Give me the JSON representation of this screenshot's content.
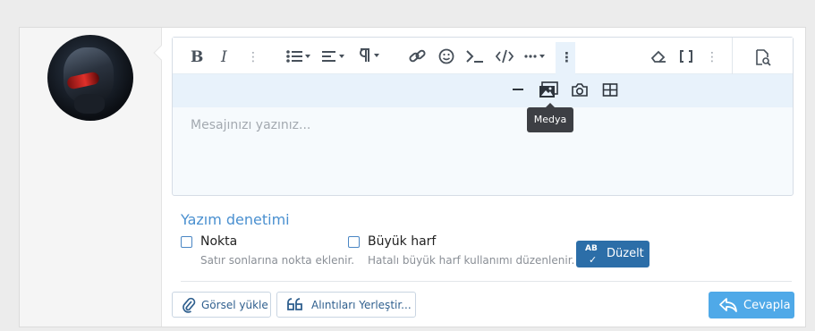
{
  "editor": {
    "placeholder": "Mesajınızı yazınız...",
    "tooltip": "Medya",
    "toolbar_icons": [
      "bold-icon",
      "italic-icon",
      "more-icon",
      "list-icon",
      "align-icon",
      "paragraph-icon",
      "link-icon",
      "smiley-icon",
      "code-prompt-icon",
      "code-icon",
      "ellipsis-icon",
      "more-active-icon",
      "eraser-icon",
      "brackets-icon",
      "more-icon",
      "preview-icon"
    ],
    "toolbar2_icons": [
      "horizontal-rule-icon",
      "media-icon",
      "camera-icon",
      "table-icon"
    ]
  },
  "spellcheck": {
    "title": "Yazım denetimi",
    "options": [
      {
        "label": "Nokta",
        "hint": "Satır sonlarına nokta eklenir."
      },
      {
        "label": "Büyük harf",
        "hint": "Hatalı büyük harf kullanımı düzenlenir."
      }
    ],
    "fix_button": {
      "badge": "AB",
      "label": "Düzelt"
    }
  },
  "actions": {
    "upload_label": "Görsel yükle",
    "quote_label": "Alıntıları Yerleştir...",
    "reply_label": "Cevapla"
  },
  "colors": {
    "accent": "#4a90d0",
    "primary": "#2c6ea8",
    "reply": "#4fa9e8"
  }
}
